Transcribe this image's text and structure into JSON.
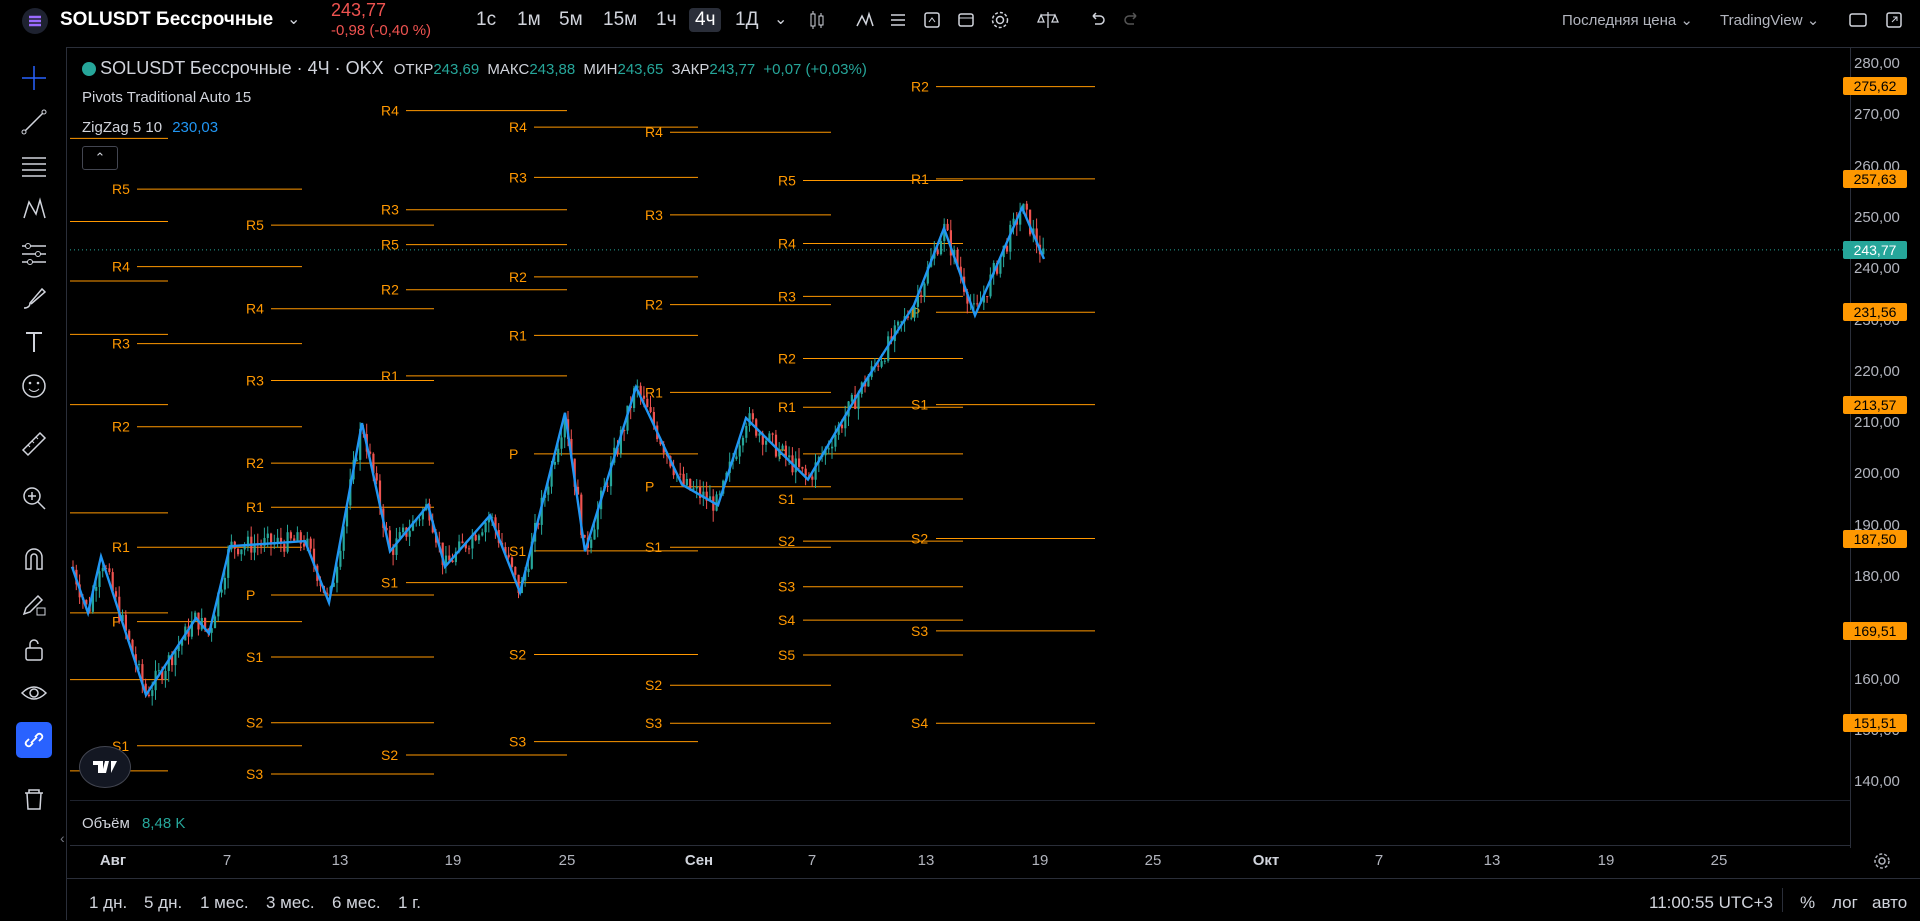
{
  "header": {
    "symbol": "SOLUSDT Бессрочные",
    "price": "243,77",
    "change": "-0,98 (-0,40 %)",
    "timeframes": [
      "1с",
      "1м",
      "5м",
      "15м",
      "1ч",
      "4ч",
      "1Д"
    ],
    "active_timeframe": "4ч",
    "price_mode": "Последняя цена",
    "provider": "TradingView"
  },
  "legend": {
    "title": "SOLUSDT Бессрочные · 4Ч · OKX",
    "open_label": "ОТКР",
    "open_value": "243,69",
    "high_label": "МАКС",
    "high_value": "243,88",
    "low_label": "МИН",
    "low_value": "243,65",
    "close_label": "ЗАКР",
    "close_value": "243,77",
    "change_value": "+0,07 (+0,03%)",
    "pivots": "Pivots Traditional Auto 15",
    "zigzag": "ZigZag 5 10",
    "zigzag_value": "230,03"
  },
  "volume": {
    "label": "Объём",
    "value": "8,48 K"
  },
  "price_axis": {
    "ticks": [
      "280,00",
      "270,00",
      "260,00",
      "250,00",
      "240,00",
      "230,00",
      "220,00",
      "210,00",
      "200,00",
      "190,00",
      "180,00",
      "170,00",
      "160,00",
      "150,00",
      "140,00"
    ],
    "boxes": [
      {
        "label": "275,62",
        "color": "#ff9800"
      },
      {
        "label": "257,63",
        "color": "#ff9800"
      },
      {
        "label": "243,77",
        "color": "#26a69a"
      },
      {
        "label": "231,56",
        "color": "#ff9800"
      },
      {
        "label": "213,57",
        "color": "#ff9800"
      },
      {
        "label": "187,50",
        "color": "#ff9800"
      },
      {
        "label": "169,51",
        "color": "#ff9800"
      },
      {
        "label": "151,51",
        "color": "#ff9800"
      }
    ]
  },
  "time_axis": {
    "labels": [
      "Авг",
      "7",
      "13",
      "19",
      "25",
      "Сен",
      "7",
      "13",
      "19",
      "25",
      "Окт",
      "7",
      "13",
      "19",
      "25"
    ]
  },
  "bottom": {
    "ranges": [
      "1 дн.",
      "5 дн.",
      "1 мес.",
      "3 мес.",
      "6 мес.",
      "1 г."
    ],
    "clock": "11:00:55 UTC+3",
    "percent": "%",
    "log": "лог",
    "auto": "авто"
  },
  "pivot_labels": [
    "R5",
    "R4",
    "R3",
    "R2",
    "R1",
    "P",
    "S1",
    "S2",
    "S3",
    "S4",
    "S5"
  ],
  "colors": {
    "up": "#26a69a",
    "down": "#ef5350",
    "pivot": "#ff9800",
    "zigzag": "#2196f3",
    "accent": "#2962ff"
  }
}
